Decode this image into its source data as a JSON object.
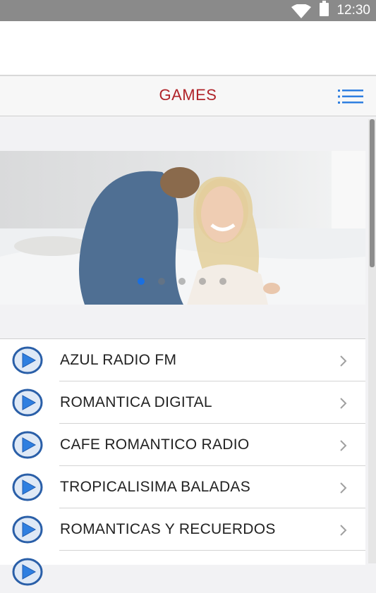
{
  "status_bar": {
    "time": "12:30"
  },
  "nav": {
    "title": "GAMES",
    "accent_color": "#b0242a",
    "menu_icon": "list-menu-icon"
  },
  "carousel": {
    "active_index": 0,
    "count": 5,
    "active_color": "#1a6fe0"
  },
  "stations": [
    {
      "label": "AZUL RADIO FM"
    },
    {
      "label": "ROMANTICA DIGITAL"
    },
    {
      "label": "CAFE ROMANTICO RADIO"
    },
    {
      "label": "TROPICALISIMA BALADAS"
    },
    {
      "label": "ROMANTICAS Y RECUERDOS"
    },
    {
      "label": ""
    }
  ]
}
